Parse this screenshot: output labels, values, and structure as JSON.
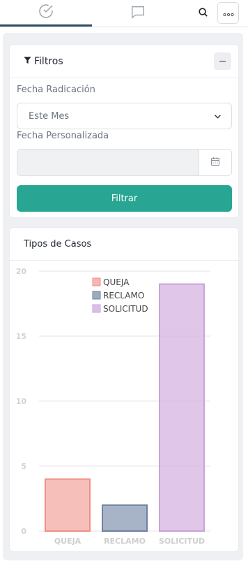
{
  "nav": {
    "tabs": [
      {
        "icon": "check-circle-icon",
        "active": true
      },
      {
        "icon": "chat-icon",
        "active": false
      }
    ],
    "search_icon": "search-icon",
    "more_icon": "more-dots-icon"
  },
  "filters": {
    "title": "Filtros",
    "title_icon": "filter-icon",
    "collapse_icon": "minus-icon",
    "date_label": "Fecha Radicación",
    "date_value": "Este Mes",
    "custom_label": "Fecha Personalizada",
    "custom_value": "",
    "calendar_icon": "calendar-icon",
    "button_label": "Filtrar"
  },
  "colors": {
    "accent": "#28a693",
    "tab_indicator": "#2e4e63",
    "queja": "#f4a9a3",
    "reclamo": "#8a9bb5",
    "solicitud": "#d6b4e3"
  },
  "chart": {
    "title": "Tipos de Casos"
  },
  "chart_data": {
    "type": "bar",
    "categories": [
      "QUEJA",
      "RECLAMO",
      "SOLICITUD"
    ],
    "values": [
      4,
      2,
      19
    ],
    "ylim": [
      0,
      20
    ],
    "yticks": [
      0,
      5,
      10,
      15,
      20
    ],
    "grid": true,
    "legend": "top-center",
    "legend_entries": [
      "QUEJA",
      "RECLAMO",
      "SOLICITUD"
    ],
    "colors": [
      "#f4a9a3",
      "#8a9bb5",
      "#d6b4e3"
    ]
  }
}
